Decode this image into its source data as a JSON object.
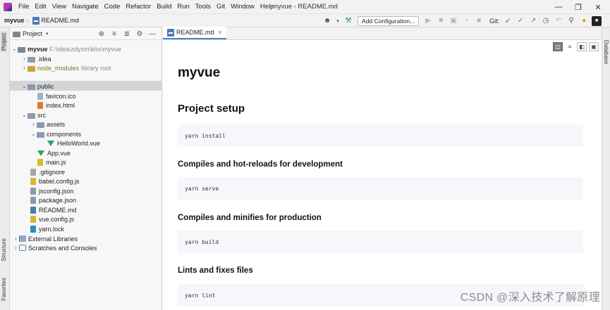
{
  "menubar": {
    "items": [
      "File",
      "Edit",
      "View",
      "Navigate",
      "Code",
      "Refactor",
      "Build",
      "Run",
      "Tools",
      "Git",
      "Window",
      "Help"
    ],
    "window_title": "myvue - README.md"
  },
  "toolbar": {
    "crumb_project": "myvue",
    "crumb_file": "README.md",
    "add_config_label": "Add Configuration...",
    "git_label": "Git:"
  },
  "left_strip": {
    "tabs": [
      "Project",
      "Structure",
      "Favorites"
    ]
  },
  "right_strip": {
    "tabs": [
      "Database"
    ]
  },
  "project_panel": {
    "title": "Project",
    "tree": {
      "root_name": "myvue",
      "root_path": "F:\\idea\\zdyxm\\khx\\myvue",
      "idea": ".idea",
      "node_modules": "node_modules",
      "node_modules_hint": "library root",
      "public": "public",
      "favicon": "favicon.ico",
      "index_html": "index.html",
      "src": "src",
      "assets": "assets",
      "components": "components",
      "helloworld": "HelloWorld.vue",
      "app_vue": "App.vue",
      "main_js": "main.js",
      "gitignore": ".gitignore",
      "babel": "babel.config.js",
      "jsconfig": "jsconfig.json",
      "package": "package.json",
      "readme": "README.md",
      "vueconfig": "vue.config.js",
      "yarnlock": "yarn.lock",
      "external": "External Libraries",
      "scratches": "Scratches and Consoles"
    }
  },
  "editor": {
    "tab_label": "README.md",
    "markdown": {
      "h1": "myvue",
      "setup_heading": "Project setup",
      "setup_code": "yarn install",
      "dev_heading": "Compiles and hot-reloads for development",
      "dev_code": "yarn serve",
      "prod_heading": "Compiles and minifies for production",
      "prod_code": "yarn build",
      "lint_heading": "Lints and fixes files",
      "lint_code": "yarn lint"
    }
  },
  "watermark": "CSDN @深入技术了解原理",
  "colors": {
    "accent": "#4083c9",
    "vue_green": "#2fa06c",
    "code_bg": "#f5f7fa",
    "selection": "#d5d5d5",
    "library_text": "#7a7a28"
  },
  "icons": {
    "toolbar": [
      "person-icon",
      "hammer-icon",
      "run-icon",
      "debug-icon",
      "coverage-icon",
      "profile-icon",
      "stop-icon",
      "git-update-icon",
      "git-commit-icon",
      "git-push-icon",
      "history-icon",
      "rollback-icon",
      "search-icon",
      "update-icon",
      "ide-logo-icon"
    ],
    "view_toggles": [
      "editor-and-preview-icon",
      "editor-only-icon",
      "split-icon",
      "preview-only-icon"
    ]
  }
}
